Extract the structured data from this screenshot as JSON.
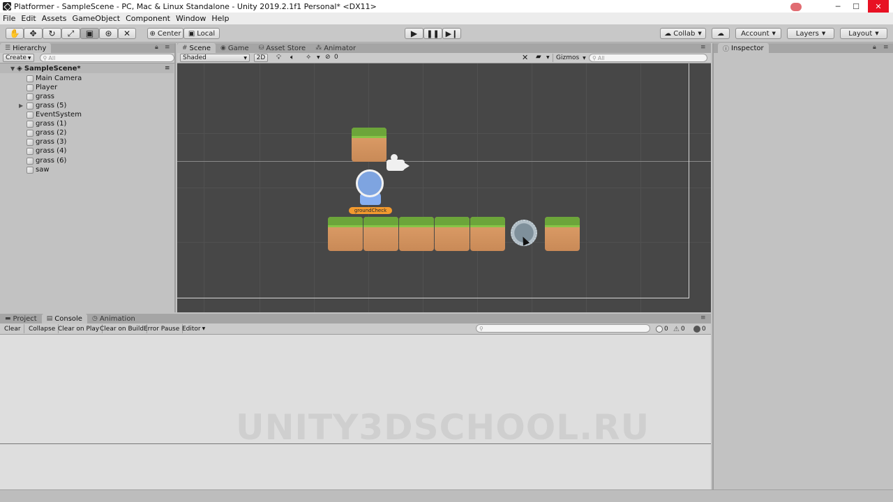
{
  "window": {
    "title": "Platformer - SampleScene - PC, Mac & Linux Standalone - Unity 2019.2.1f1 Personal* <DX11>",
    "controls": [
      "─",
      "☐",
      "✕"
    ]
  },
  "menu": [
    "File",
    "Edit",
    "Assets",
    "GameObject",
    "Component",
    "Window",
    "Help"
  ],
  "toolbar": {
    "tools": [
      "hand-tool",
      "move-tool",
      "rotate-tool",
      "scale-tool",
      "rect-tool",
      "transform-tool",
      "custom-tool"
    ],
    "pivot_label": "Center",
    "space_label": "Local",
    "collab_label": "Collab",
    "account_label": "Account",
    "layers_label": "Layers",
    "layout_label": "Layout"
  },
  "hierarchy": {
    "tab": "Hierarchy",
    "create_label": "Create",
    "search_placeholder": "All",
    "scene_name": "SampleScene*",
    "items": [
      "Main Camera",
      "Player",
      "grass",
      "grass (5)",
      "EventSystem",
      "grass (1)",
      "grass (2)",
      "grass (3)",
      "grass (4)",
      "grass (6)",
      "saw"
    ]
  },
  "scene_tabs": [
    "Scene",
    "Game",
    "Asset Store",
    "Animator"
  ],
  "scene_toolbar": {
    "draw_mode": "Shaded",
    "mode_2d": "2D",
    "fx_count": "0",
    "gizmos_label": "Gizmos",
    "search_placeholder": "All"
  },
  "scene_objects": {
    "ground_check_label": "groundCheck"
  },
  "inspector": {
    "tab": "Inspector"
  },
  "bottom_tabs": [
    "Project",
    "Console",
    "Animation"
  ],
  "console_toolbar": {
    "buttons": [
      "Clear",
      "Collapse",
      "Clear on Play",
      "Clear on Build",
      "Error Pause",
      "Editor"
    ],
    "info_count": "0",
    "warning_count": "0",
    "error_count": "0"
  },
  "watermark": "UNITY3DSCHOOL.RU",
  "colors": {
    "scene_bg": "#474747",
    "grass_green": "#6ca53a",
    "dirt_orange": "#d99a64",
    "ground_check": "#f39a2e"
  }
}
